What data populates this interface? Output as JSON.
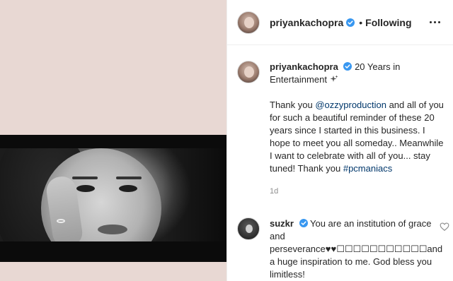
{
  "post": {
    "author": "priyankachopra",
    "follow_separator": "•",
    "follow_status": "Following",
    "caption_title": "20 Years in Entertainment",
    "caption_intro": "Thank you ",
    "caption_mention": "@ozzyproduction",
    "caption_body": " and all of you for such a beautiful reminder of these 20 years since I started in this business. I hope to meet you all someday.. Meanwhile I want to celebrate with all of you... stay tuned! Thank you ",
    "caption_hashtag": "#pcmaniacs",
    "time_ago": "1d"
  },
  "comment": {
    "author": "suzkr",
    "text": "You are an institution of grace and perseverance♥♥☐☐☐☐☐☐☐☐☐☐☐and a huge inspiration to me. God bless you limitless!"
  },
  "icons": {
    "verified": "verified-badge-icon",
    "more": "more-options-icon",
    "sparkle": "sparkles-emoji-icon",
    "like": "heart-outline-icon"
  },
  "colors": {
    "media_background": "#e8d8d3",
    "verified_blue": "#3897f0",
    "link_blue": "#00376b",
    "muted_text": "#8e8e8e"
  }
}
